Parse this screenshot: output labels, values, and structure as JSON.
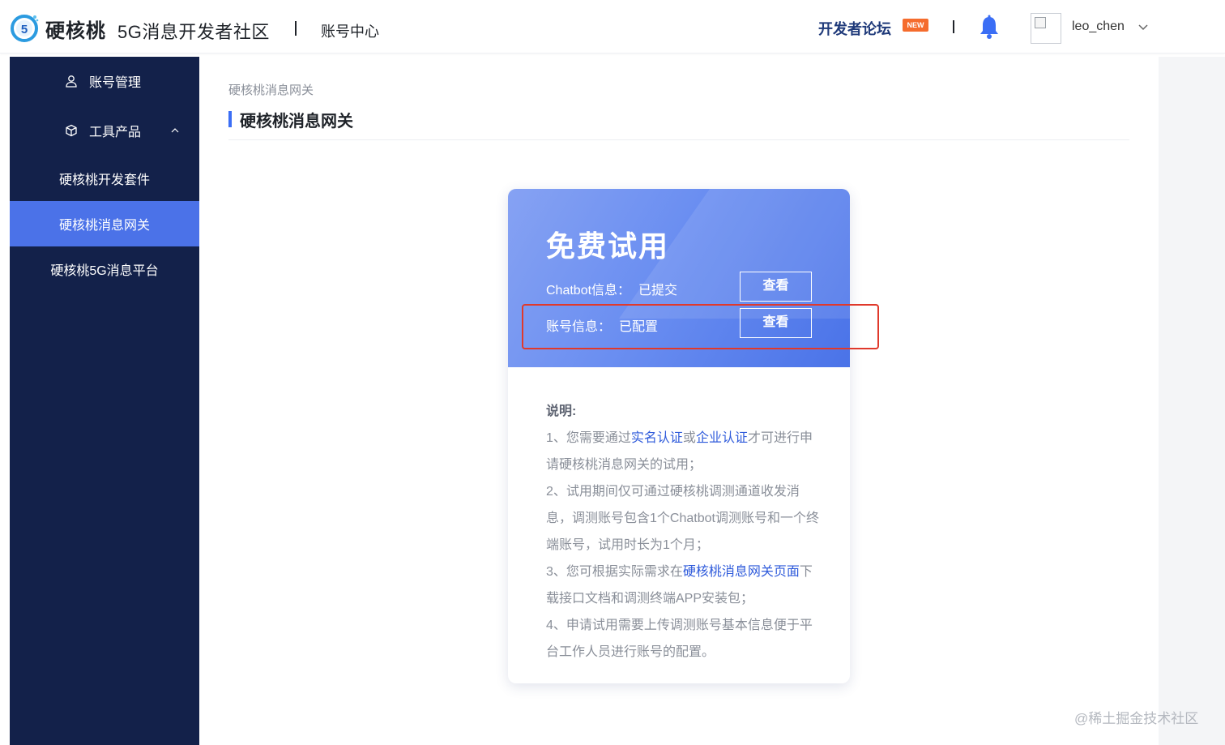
{
  "header": {
    "brand": "硬核桃",
    "product": "5G消息开发者社区",
    "section": "账号中心",
    "forum_label": "开发者论坛",
    "new_badge": "NEW",
    "username": "leo_chen",
    "icons": [
      "logo-5-icon",
      "bell-icon",
      "avatar-broken-image-icon",
      "chevron-down-icon"
    ]
  },
  "sidebar": {
    "items": [
      {
        "label": "账号管理",
        "icon": "user-icon"
      },
      {
        "label": "工具产品",
        "icon": "cube-icon"
      },
      {
        "label": "硬核桃开发套件"
      },
      {
        "label": "硬核桃消息网关",
        "active": true
      },
      {
        "label": "硬核桃5G消息平台"
      }
    ]
  },
  "main": {
    "breadcrumb": "硬核桃消息网关",
    "title": "硬核桃消息网关"
  },
  "card": {
    "title": "免费试用",
    "rows": [
      {
        "label": "Chatbot信息：",
        "status": "已提交",
        "button": "查看"
      },
      {
        "label": "账号信息：",
        "status": "已配置",
        "button": "查看"
      }
    ],
    "description": {
      "heading": "说明:",
      "p1_a": "1、您需要通过",
      "p1_link1": "实名认证",
      "p1_b": "或",
      "p1_link2": "企业认证",
      "p1_c": "才可进行申请硬核桃消息网关的试用；",
      "p2": "2、试用期间仅可通过硬核桃调测通道收发消息，调测账号包含1个Chatbot调测账号和一个终端账号，试用时长为1个月；",
      "p3_a": "3、您可根据实际需求在",
      "p3_link": "硬核桃消息网关页面",
      "p3_b": "下载接口文档和调测终端APP安装包；",
      "p4": "4、申请试用需要上传调测账号基本信息便于平台工作人员进行账号的配置。"
    }
  },
  "watermark": "@稀土掘金技术社区",
  "colors": {
    "sidebar_bg": "#13214a",
    "sidebar_active": "#4b72e8",
    "accent": "#3b6ef5",
    "link": "#2f5bdb",
    "highlight": "#e0392b"
  }
}
